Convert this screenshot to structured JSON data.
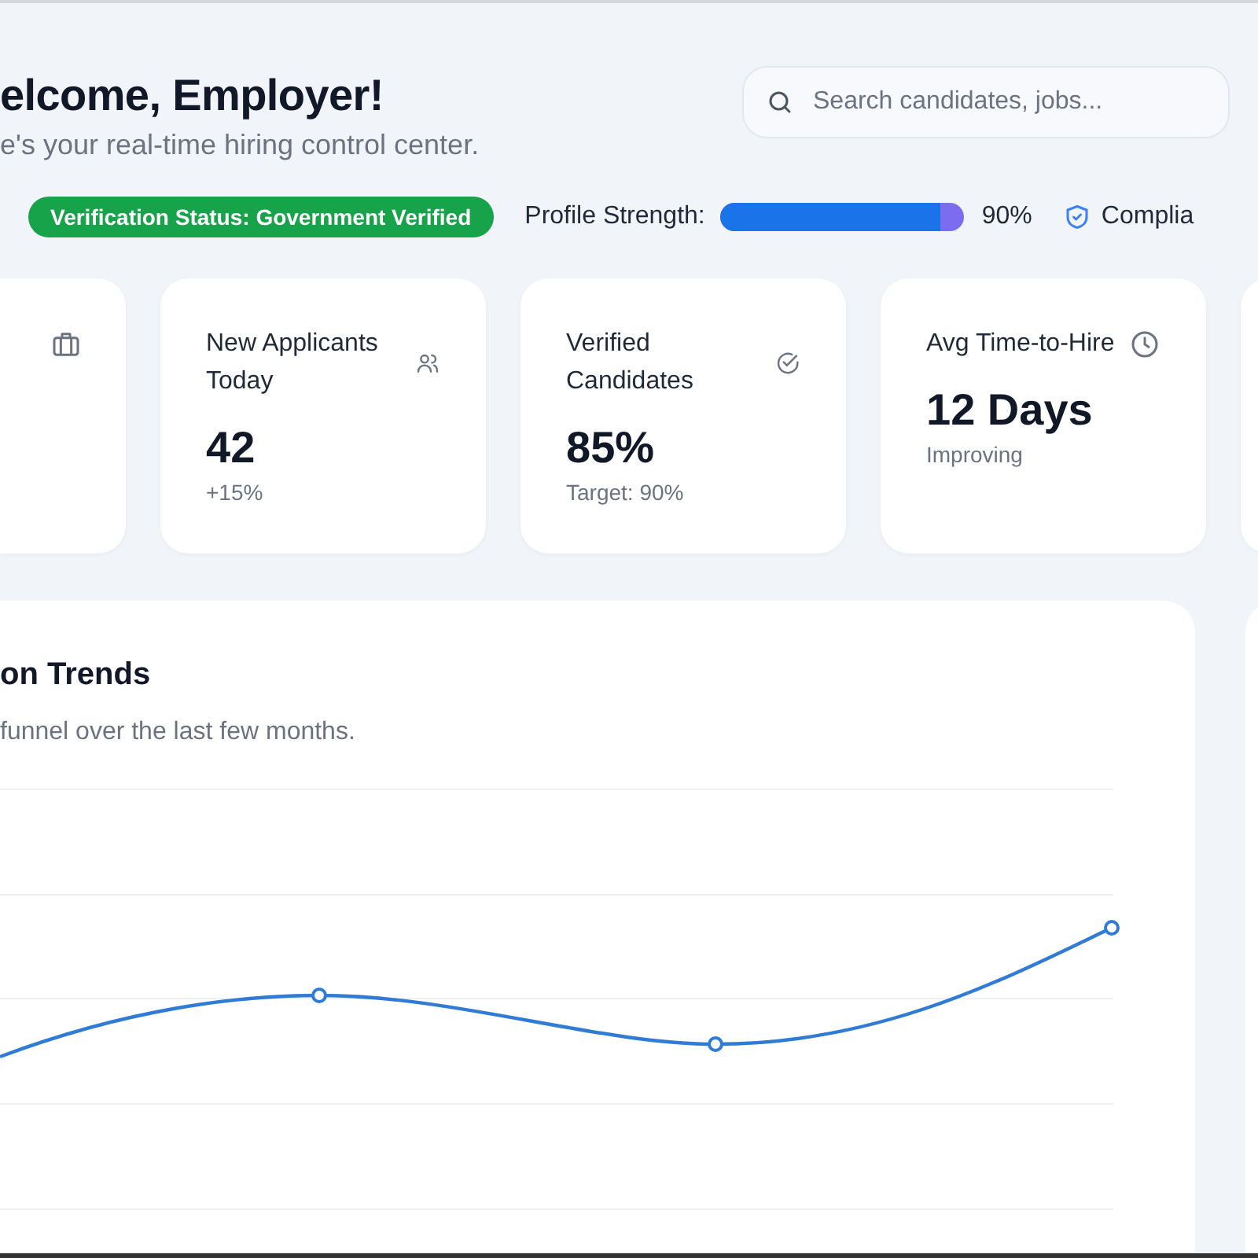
{
  "header": {
    "title": "elcome, Employer!",
    "subtitle": "e's your real-time hiring control center.",
    "search": {
      "placeholder": "Search candidates, jobs..."
    }
  },
  "status_row": {
    "badge": "Verification Status: Government Verified",
    "profile_label": "Profile Strength:",
    "profile": {
      "level": 0.9
    },
    "profile_reading": "90%",
    "compliance": "Complia"
  },
  "stat_cards": [
    {
      "title": "New Applicants Today",
      "value": "42",
      "note": "+15%",
      "kind": "users"
    },
    {
      "title": "Verified Candidates",
      "value": "85%",
      "note": "Target: 90%",
      "kind": "check"
    },
    {
      "title": "Avg Time-to-Hire",
      "value": "12 Days",
      "note": "Improving",
      "kind": "clock"
    }
  ],
  "trend_panel": {
    "title": "on Trends",
    "subtitle": "funnel over the last few months."
  }
}
